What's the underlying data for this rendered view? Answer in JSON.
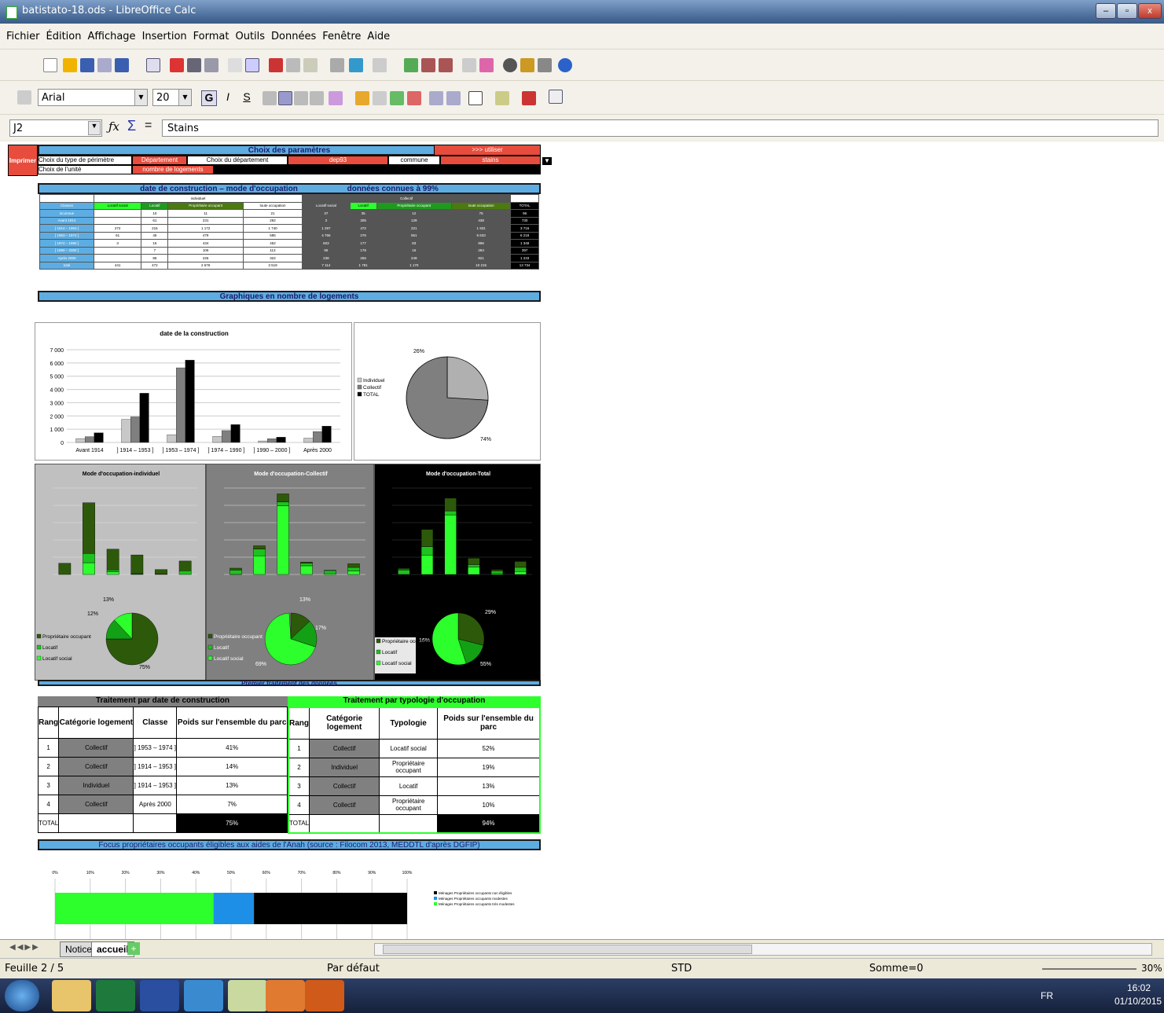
{
  "window": {
    "title": "batistato-18.ods - LibreOffice Calc"
  },
  "menu": [
    "Fichier",
    "Édition",
    "Affichage",
    "Insertion",
    "Format",
    "Outils",
    "Données",
    "Fenêtre",
    "Aide"
  ],
  "toolbar": {
    "font": "Arial",
    "size": "20",
    "bold": "G",
    "italic": "I",
    "underline": "S"
  },
  "formula": {
    "cell": "J2",
    "content": "Stains",
    "fx": "ƒx",
    "sigma": "Σ",
    "equals": "="
  },
  "params": {
    "print": "Imprimer",
    "title": "Choix des paramètres",
    "use": ">>> utiliser",
    "perimeter_label": "Choix du type de périmètre",
    "perimeter_value": "Département",
    "dept_label": "Choix du département",
    "dept_value": "dep93",
    "commune_label": "commune",
    "commune_value": "stains",
    "unit_label": "Choix de l'unité",
    "unit_value": "nombre de logements"
  },
  "construction_table": {
    "title": "date de construction – mode d'occupation",
    "known": "données connues à 99%",
    "group_ind": "individuel",
    "group_col": "Collectif",
    "headers": [
      "Classes",
      "Locatif social",
      "Locatif",
      "Propriétaire occupant",
      "toute occupation",
      "Locatif social",
      "Locatif",
      "Propriétaire occupant",
      "toute occupation",
      "TOTAL"
    ],
    "rows": [
      [
        "inconnue",
        "",
        "10",
        "11",
        "21",
        "37",
        "35",
        "12",
        "75",
        "96"
      ],
      [
        "Avant 1914",
        "",
        "61",
        "231",
        "292",
        "3",
        "305",
        "129",
        "438",
        "730"
      ],
      [
        "] 1914 – 1953 ]",
        "272",
        "215",
        "1 172",
        "1 740",
        "1 297",
        "472",
        "221",
        "1 931",
        "3 716"
      ],
      [
        "] 1953 – 1974 ]",
        "61",
        "45",
        "479",
        "585",
        "4 766",
        "276",
        "551",
        "5 633",
        "6 218"
      ],
      [
        "] 1974 – 1990 ]",
        "3",
        "15",
        "434",
        "452",
        "603",
        "177",
        "83",
        "896",
        "1 348"
      ],
      [
        "] 1990 – 2000 ]",
        "",
        "7",
        "106",
        "113",
        "95",
        "178",
        "16",
        "284",
        "397"
      ],
      [
        "Après 2000",
        "",
        "85",
        "226",
        "322",
        "238",
        "256",
        "249",
        "821",
        "1 233"
      ],
      [
        "total",
        "441",
        "472",
        "2 676",
        "3 519",
        "7 114",
        "1 781",
        "1 170",
        "10 215",
        "13 734"
      ]
    ]
  },
  "graphs_title": "Graphiques en nombre de logements",
  "bar_chart": {
    "title": "date de la construction",
    "categories": [
      "Avant 1914",
      "] 1914 – 1953 ]",
      "] 1953 – 1974 ]",
      "] 1974 – 1990 ]",
      "] 1990 – 2000 ]",
      "Après 2000"
    ],
    "series": [
      {
        "name": "Individuel",
        "color": "#c8c8c8",
        "values": [
          292,
          1740,
          585,
          452,
          113,
          322
        ]
      },
      {
        "name": "Collectif",
        "color": "#7f7f7f",
        "values": [
          438,
          1931,
          5633,
          896,
          284,
          821
        ]
      },
      {
        "name": "TOTAL",
        "color": "#000000",
        "values": [
          730,
          3716,
          6218,
          1348,
          397,
          1233
        ]
      }
    ],
    "yticks": [
      "0",
      "1 000",
      "2 000",
      "3 000",
      "4 000",
      "5 000",
      "6 000",
      "7 000"
    ],
    "ymax": 7000
  },
  "pie_main": {
    "labels": [
      "Individuel",
      "Collectif",
      "TOTAL"
    ],
    "pct": [
      "26%",
      "74%"
    ],
    "values": [
      26,
      74
    ]
  },
  "mode_charts": [
    {
      "title": "Mode d'occupation-individuel",
      "bg": "#c0c0c0",
      "pct": [
        "13%",
        "12%",
        "75%"
      ]
    },
    {
      "title": "Mode d'occupation-Collectif",
      "bg": "#808080",
      "pct": [
        "13%",
        "17%",
        "69%"
      ]
    },
    {
      "title": "Mode d'occupation-Total",
      "bg": "#000000",
      "pct": [
        "29%",
        "55%",
        "16%"
      ]
    }
  ],
  "mode_legend": [
    "Propriétaire occupant",
    "Locatif",
    "Locatif social"
  ],
  "premier_title": "Premier traitement des données",
  "rank_tables": {
    "left_title": "Traitement par date de construction",
    "right_title": "Traitement par typologie d'occupation",
    "left_headers": [
      "Rang",
      "Catégorie logement",
      "Classe",
      "Poids sur l'ensemble du parc"
    ],
    "right_headers": [
      "Rang",
      "Catégorie logement",
      "Typologie",
      "Poids sur l'ensemble du parc"
    ],
    "left_rows": [
      [
        "1",
        "Collectif",
        "] 1953 – 1974 ]",
        "41%"
      ],
      [
        "2",
        "Collectif",
        "] 1914 – 1953 ]",
        "14%"
      ],
      [
        "3",
        "Individuel",
        "] 1914 – 1953 ]",
        "13%"
      ],
      [
        "4",
        "Collectif",
        "Après 2000",
        "7%"
      ],
      [
        "TOTAL",
        "",
        "",
        "75%"
      ]
    ],
    "right_rows": [
      [
        "1",
        "Collectif",
        "Locatif social",
        "52%"
      ],
      [
        "2",
        "Individuel",
        "Propriétaire occupant",
        "19%"
      ],
      [
        "3",
        "Collectif",
        "Locatif",
        "13%"
      ],
      [
        "4",
        "Collectif",
        "Propriétaire occupant",
        "10%"
      ],
      [
        "TOTAL",
        "",
        "",
        "94%"
      ]
    ]
  },
  "focus": {
    "title": "Focus propriétaires occupants éligibles aux aides de l'Anah (source : Filocom 2013, MEDDTL d'après DGFIP)",
    "ticks": [
      "0%",
      "10%",
      "20%",
      "30%",
      "40%",
      "50%",
      "60%",
      "70%",
      "80%",
      "90%",
      "100%"
    ],
    "segments": [
      {
        "color": "#2cff2c",
        "value": 45
      },
      {
        "color": "#1e8fe6",
        "value": 11.5
      },
      {
        "color": "#000000",
        "value": 43.5
      }
    ],
    "legend": [
      "Ménages Propriétaires occupants non éligibles",
      "Ménages Propriétaires occupants modestes",
      "Ménages Propriétaires occupants très modestes"
    ]
  },
  "tabs": [
    "Notice",
    "accueil"
  ],
  "status": {
    "sheet": "Feuille 2 / 5",
    "style": "Par défaut",
    "mode": "STD",
    "sum": "Somme=0",
    "zoom": "30%"
  },
  "taskbar": {
    "lang": "FR",
    "time": "16:02",
    "date": "01/10/2015"
  }
}
